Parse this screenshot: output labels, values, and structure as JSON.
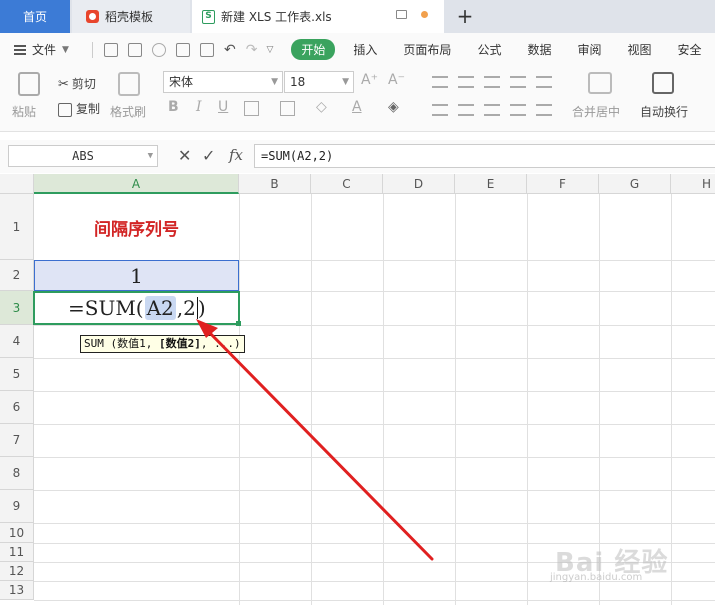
{
  "tabs": {
    "home": "首页",
    "template": "稻壳模板",
    "file": "新建 XLS 工作表.xls",
    "xls_icon": "S",
    "new_tab": "+"
  },
  "menu": {
    "file": "文件",
    "items": [
      "开始",
      "插入",
      "页面布局",
      "公式",
      "数据",
      "审阅",
      "视图",
      "安全"
    ]
  },
  "ribbon": {
    "paste": "粘贴",
    "cut": "剪切",
    "copy": "复制",
    "format_painter": "格式刷",
    "font_name": "宋体",
    "font_size": "18",
    "font_grow": "A⁺",
    "font_shrink": "A⁻",
    "bold": "B",
    "italic": "I",
    "underline": "U",
    "merge_center": "合并居中",
    "wrap_text": "自动换行"
  },
  "formula_bar": {
    "name_box": "ABS",
    "cancel": "✕",
    "confirm": "✓",
    "fx": "fx",
    "formula": "=SUM(A2,2)"
  },
  "grid": {
    "columns": [
      "A",
      "B",
      "C",
      "D",
      "E",
      "F",
      "G",
      "H"
    ],
    "rows": [
      "1",
      "2",
      "3",
      "4",
      "5",
      "6",
      "7",
      "8",
      "9",
      "10",
      "11",
      "12",
      "13"
    ],
    "a1": "间隔序列号",
    "a2": "1",
    "a3_prefix": "=SUM(",
    "a3_ref": "A2",
    "a3_suffix": ",2",
    "a3_close": ")"
  },
  "tooltip": {
    "func": "SUM (数值1, ",
    "arg_bold": "[数值2]",
    "rest": ", ...)"
  },
  "watermark": {
    "main": "Bai 经验",
    "sub": "jingyan.baidu.com"
  },
  "colors": {
    "accent_green": "#2e9c5e",
    "accent_blue": "#3c7bd6",
    "title_red": "#d22525",
    "arrow_red": "#e02020"
  }
}
